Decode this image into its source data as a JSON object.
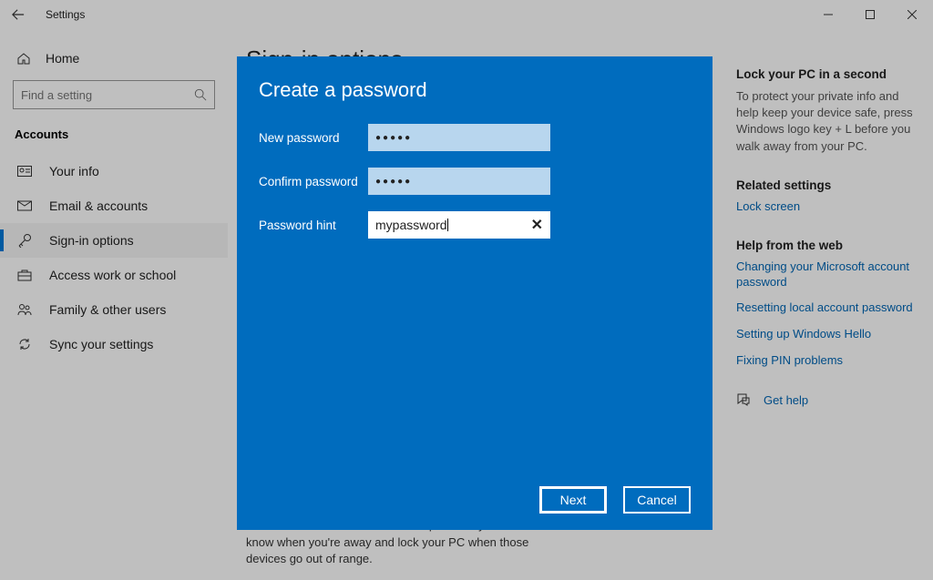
{
  "titlebar": {
    "title": "Settings"
  },
  "sidebar": {
    "home": "Home",
    "search_placeholder": "Find a setting",
    "category": "Accounts",
    "items": [
      {
        "label": "Your info"
      },
      {
        "label": "Email & accounts"
      },
      {
        "label": "Sign-in options"
      },
      {
        "label": "Access work or school"
      },
      {
        "label": "Family & other users"
      },
      {
        "label": "Sync your settings"
      }
    ]
  },
  "main": {
    "page_title": "Sign-in options",
    "dynamic_lock_text": "Windows can use devices that are paired to your PC to know when you're away and lock your PC when those devices go out of range."
  },
  "rightcol": {
    "lock_head": "Lock your PC in a second",
    "lock_text": "To protect your private info and help keep your device safe, press Windows logo key + L before you walk away from your PC.",
    "related_head": "Related settings",
    "related_link": "Lock screen",
    "help_head": "Help from the web",
    "help_links": [
      "Changing your Microsoft account password",
      "Resetting local account password",
      "Setting up Windows Hello",
      "Fixing PIN problems"
    ],
    "get_help": "Get help"
  },
  "modal": {
    "title": "Create a password",
    "new_pw_label": "New password",
    "confirm_pw_label": "Confirm password",
    "hint_label": "Password hint",
    "new_pw_masked": "●●●●●",
    "confirm_pw_masked": "●●●●●",
    "hint_value": "mypassword",
    "next": "Next",
    "cancel": "Cancel"
  }
}
